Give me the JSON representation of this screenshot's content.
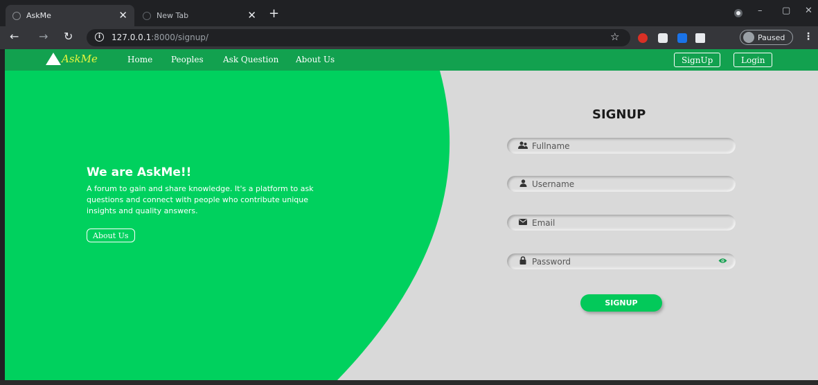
{
  "browser": {
    "tabs": [
      {
        "title": "AskMe",
        "active": true
      },
      {
        "title": "New Tab",
        "active": false
      }
    ],
    "new_tab": "+",
    "url_host": "127.0.0.1",
    "url_path": ":8000/signup/",
    "profile_status": "Paused",
    "window_controls": {
      "minimize": "–",
      "maximize": "▢",
      "close": "✕"
    }
  },
  "navbar": {
    "brand": "AskMe",
    "links": [
      "Home",
      "Peoples",
      "Ask Question",
      "About Us"
    ],
    "signup_label": "SignUp",
    "login_label": "Login"
  },
  "hero": {
    "title": "We are AskMe!!",
    "description": "A forum to gain and share knowledge. It's a platform to ask questions and connect with people who contribute unique insights and quality answers.",
    "about_button": "About Us"
  },
  "form": {
    "title": "SIGNUP",
    "fields": [
      {
        "placeholder": "Fullname",
        "icon": "users-icon"
      },
      {
        "placeholder": "Username",
        "icon": "user-icon"
      },
      {
        "placeholder": "Email",
        "icon": "envelope-icon"
      },
      {
        "placeholder": "Password",
        "icon": "lock-icon"
      }
    ],
    "submit_label": "SIGNUP"
  },
  "colors": {
    "navbar": "#12a14f",
    "hero_green": "#00d15e",
    "panel_gray": "#d9d9d9",
    "brand_yellow": "#e6f53d",
    "button_green": "#03c95a"
  }
}
